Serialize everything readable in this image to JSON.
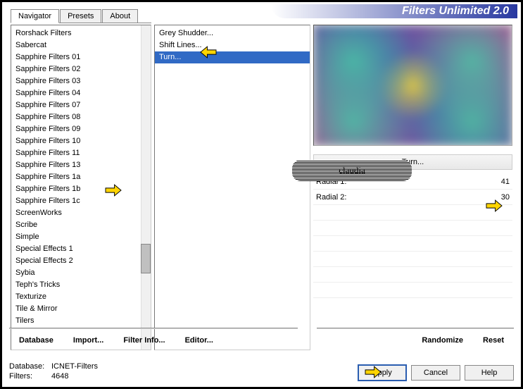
{
  "title": "Filters Unlimited 2.0",
  "tabs": [
    "Navigator",
    "Presets",
    "About"
  ],
  "active_tab": 0,
  "categories": [
    "Rorshack Filters",
    "Sabercat",
    "Sapphire Filters 01",
    "Sapphire Filters 02",
    "Sapphire Filters 03",
    "Sapphire Filters 04",
    "Sapphire Filters 07",
    "Sapphire Filters 08",
    "Sapphire Filters 09",
    "Sapphire Filters 10",
    "Sapphire Filters 11",
    "Sapphire Filters 13",
    "Sapphire Filters 1a",
    "Sapphire Filters 1b",
    "Sapphire Filters 1c",
    "ScreenWorks",
    "Scribe",
    "Simple",
    "Special Effects 1",
    "Special Effects 2",
    "Sybia",
    "Teph's Tricks",
    "Texturize",
    "Tile & Mirror",
    "Tilers"
  ],
  "selected_category_index": 14,
  "filters": [
    "Grey Shudder...",
    "Shift Lines...",
    "Turn..."
  ],
  "selected_filter_index": 2,
  "watermark_text": "claudia",
  "current_filter_name": "Turn...",
  "params": [
    {
      "label": "Radial 1:",
      "value": "41"
    },
    {
      "label": "Radial 2:",
      "value": "30"
    }
  ],
  "toolbar_left": [
    "Database",
    "Import...",
    "Filter Info...",
    "Editor..."
  ],
  "toolbar_right": [
    "Randomize",
    "Reset"
  ],
  "footer": {
    "db_label": "Database:",
    "db_value": "ICNET-Filters",
    "filters_label": "Filters:",
    "filters_value": "4648"
  },
  "buttons": {
    "apply": "Apply",
    "cancel": "Cancel",
    "help": "Help"
  }
}
